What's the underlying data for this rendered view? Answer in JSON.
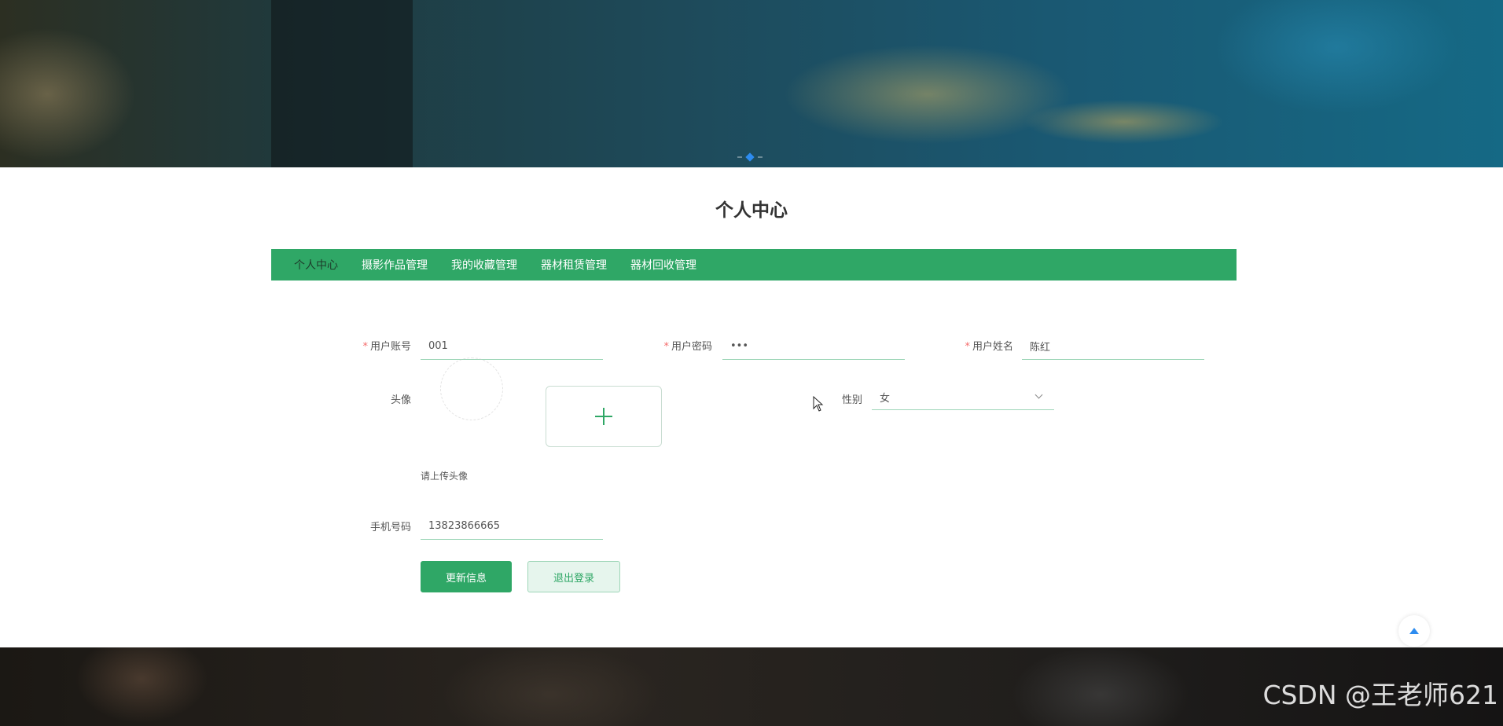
{
  "page": {
    "title": "个人中心"
  },
  "nav": {
    "items": [
      {
        "label": "个人中心",
        "active": true
      },
      {
        "label": "摄影作品管理"
      },
      {
        "label": "我的收藏管理"
      },
      {
        "label": "器材租赁管理"
      },
      {
        "label": "器材回收管理"
      }
    ]
  },
  "form": {
    "account": {
      "label": "用户账号",
      "required": "*",
      "value": "001"
    },
    "password": {
      "label": "用户密码",
      "required": "*",
      "value": "•••"
    },
    "name": {
      "label": "用户姓名",
      "required": "*",
      "value": "陈红"
    },
    "avatar": {
      "label": "头像",
      "hint": "请上传头像"
    },
    "gender": {
      "label": "性别",
      "value": "女"
    },
    "phone": {
      "label": "手机号码",
      "value": "13823866665"
    }
  },
  "buttons": {
    "update": "更新信息",
    "logout": "退出登录"
  },
  "watermark": "CSDN @王老师621",
  "colors": {
    "accent": "#2fa766",
    "required": "#f56c6c",
    "carousel_active": "#2d8cf0"
  }
}
